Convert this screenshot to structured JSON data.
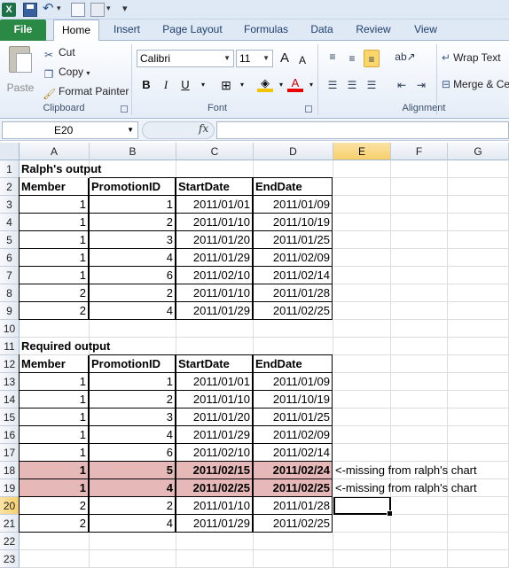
{
  "qat": {
    "logo": "X"
  },
  "tabs": [
    "File",
    "Home",
    "Insert",
    "Page Layout",
    "Formulas",
    "Data",
    "Review",
    "View"
  ],
  "clipboard": {
    "paste": "Paste",
    "cut": "Cut",
    "copy": "Copy",
    "format_painter": "Format Painter",
    "group": "Clipboard"
  },
  "font": {
    "name": "Calibri",
    "size": "11",
    "grow": "A",
    "shrink": "A",
    "bold": "B",
    "italic": "I",
    "underline": "U",
    "color": "A",
    "group": "Font"
  },
  "alignment": {
    "wrap_text": "Wrap Text",
    "merge": "Merge & Ce",
    "group": "Alignment"
  },
  "formula_bar": {
    "name_box": "E20",
    "fx": "fx",
    "value": ""
  },
  "columns": [
    "A",
    "B",
    "C",
    "D",
    "E",
    "F",
    "G"
  ],
  "rows": [
    {
      "n": "1",
      "cells": [
        "Ralph's output",
        "",
        "",
        ""
      ],
      "note": ""
    },
    {
      "n": "2",
      "cells": [
        "Member",
        "PromotionID",
        "StartDate",
        "EndDate"
      ],
      "note": ""
    },
    {
      "n": "3",
      "cells": [
        "1",
        "1",
        "2011/01/01",
        "2011/01/09"
      ],
      "note": ""
    },
    {
      "n": "4",
      "cells": [
        "1",
        "2",
        "2011/01/10",
        "2011/10/19"
      ],
      "note": ""
    },
    {
      "n": "5",
      "cells": [
        "1",
        "3",
        "2011/01/20",
        "2011/01/25"
      ],
      "note": ""
    },
    {
      "n": "6",
      "cells": [
        "1",
        "4",
        "2011/01/29",
        "2011/02/09"
      ],
      "note": ""
    },
    {
      "n": "7",
      "cells": [
        "1",
        "6",
        "2011/02/10",
        "2011/02/14"
      ],
      "note": ""
    },
    {
      "n": "8",
      "cells": [
        "2",
        "2",
        "2011/01/10",
        "2011/01/28"
      ],
      "note": ""
    },
    {
      "n": "9",
      "cells": [
        "2",
        "4",
        "2011/01/29",
        "2011/02/25"
      ],
      "note": ""
    },
    {
      "n": "10",
      "cells": [
        "",
        "",
        "",
        ""
      ],
      "note": ""
    },
    {
      "n": "11",
      "cells": [
        "Required output",
        "",
        "",
        ""
      ],
      "note": ""
    },
    {
      "n": "12",
      "cells": [
        "Member",
        "PromotionID",
        "StartDate",
        "EndDate"
      ],
      "note": ""
    },
    {
      "n": "13",
      "cells": [
        "1",
        "1",
        "2011/01/01",
        "2011/01/09"
      ],
      "note": ""
    },
    {
      "n": "14",
      "cells": [
        "1",
        "2",
        "2011/01/10",
        "2011/10/19"
      ],
      "note": ""
    },
    {
      "n": "15",
      "cells": [
        "1",
        "3",
        "2011/01/20",
        "2011/01/25"
      ],
      "note": ""
    },
    {
      "n": "16",
      "cells": [
        "1",
        "4",
        "2011/01/29",
        "2011/02/09"
      ],
      "note": ""
    },
    {
      "n": "17",
      "cells": [
        "1",
        "6",
        "2011/02/10",
        "2011/02/14"
      ],
      "note": ""
    },
    {
      "n": "18",
      "cells": [
        "1",
        "5",
        "2011/02/15",
        "2011/02/24"
      ],
      "note": "<-missing from ralph's chart"
    },
    {
      "n": "19",
      "cells": [
        "1",
        "4",
        "2011/02/25",
        "2011/02/25"
      ],
      "note": "<-missing from ralph's chart"
    },
    {
      "n": "20",
      "cells": [
        "2",
        "2",
        "2011/01/10",
        "2011/01/28"
      ],
      "note": ""
    },
    {
      "n": "21",
      "cells": [
        "2",
        "4",
        "2011/01/29",
        "2011/02/25"
      ],
      "note": ""
    },
    {
      "n": "22",
      "cells": [
        "",
        "",
        "",
        ""
      ],
      "note": ""
    },
    {
      "n": "23",
      "cells": [
        "",
        "",
        "",
        ""
      ],
      "note": ""
    }
  ],
  "colors": {
    "highlight_fill": "#e6b8b7",
    "file_tab": "#2a8a45",
    "selected_header": "#f7cf6b"
  }
}
